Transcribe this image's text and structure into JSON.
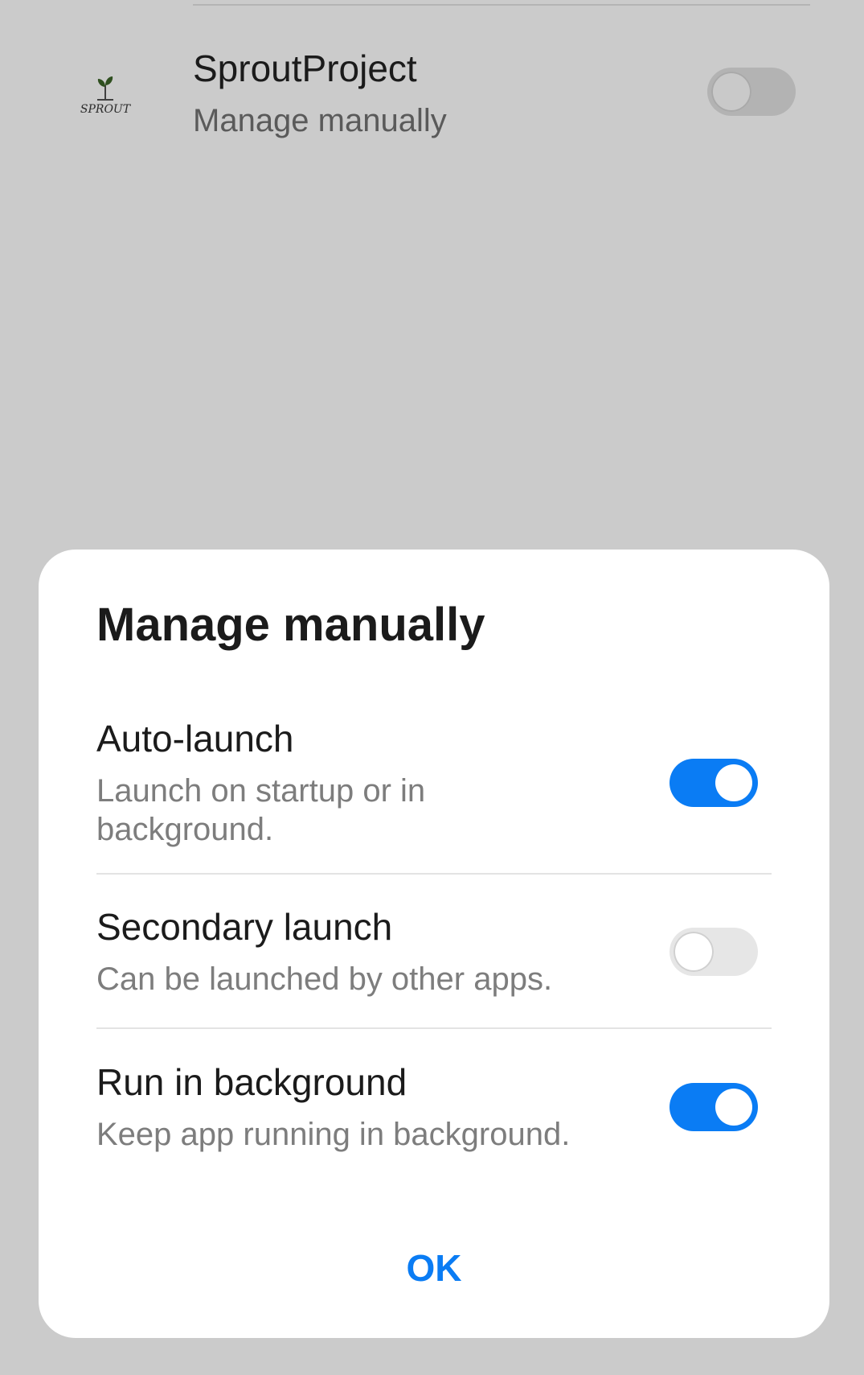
{
  "app_list": {
    "item": {
      "name": "SproutProject",
      "status": "Manage manually",
      "icon": "sprout-logo-icon",
      "icon_text": "SPROUT",
      "toggle_on": false
    }
  },
  "dialog": {
    "title": "Manage manually",
    "options": [
      {
        "title": "Auto-launch",
        "description": "Launch on startup or in background.",
        "enabled": true
      },
      {
        "title": "Secondary launch",
        "description": "Can be launched by other apps.",
        "enabled": false
      },
      {
        "title": "Run in background",
        "description": "Keep app running in background.",
        "enabled": true
      }
    ],
    "ok_label": "OK"
  },
  "colors": {
    "accent": "#0a7cf4",
    "scrim": "#cbcbcb",
    "dialog_bg": "#ffffff"
  }
}
